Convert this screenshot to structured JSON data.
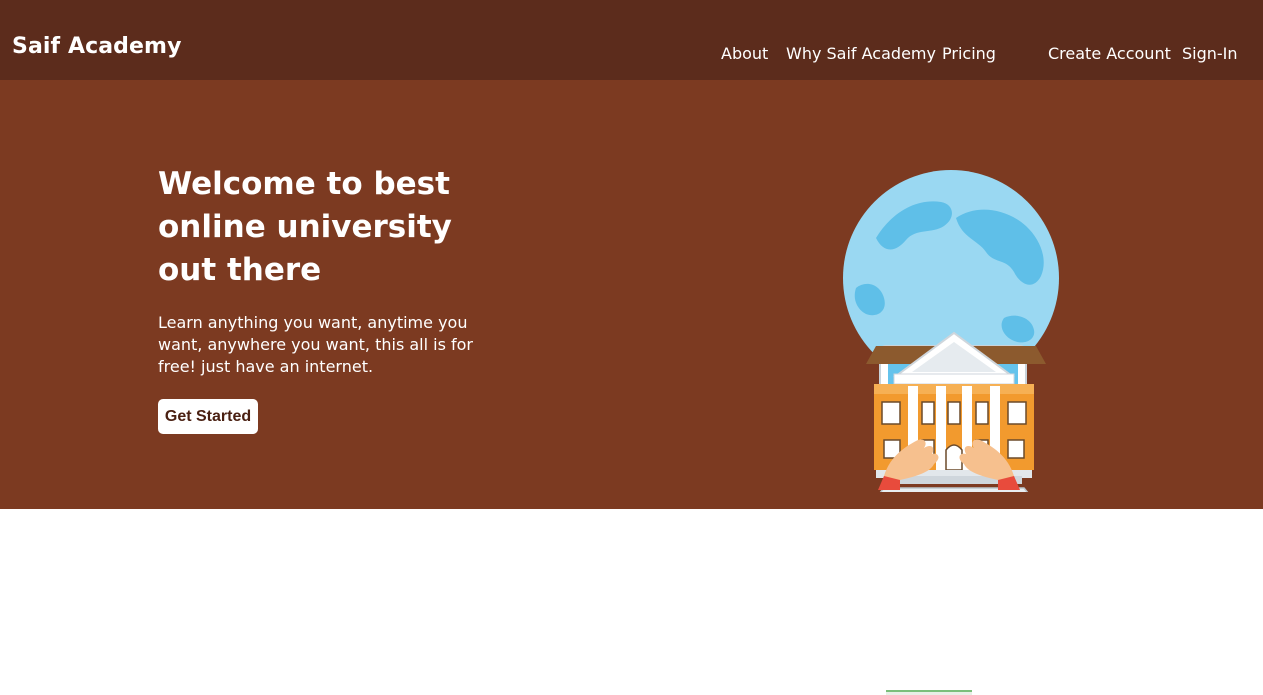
{
  "nav": {
    "brand": "Saif Academy",
    "links": {
      "about": "About",
      "why": "Why Saif Academy",
      "pricing": "Pricing",
      "create_account": "Create Account",
      "sign_in": "Sign-In"
    }
  },
  "hero": {
    "title": "Welcome to best online university out there",
    "text": "Learn anything you want, anytime you want, anywhere you want, this all is for free! just have an internet.",
    "cta_label": "Get Started",
    "illustration_icon": "university-laptop-globe-illustration"
  },
  "colors": {
    "nav_bg": "#5c2c1c",
    "hero_bg": "#7c3a21",
    "text": "#ffffff",
    "cta_text": "#4a2012"
  }
}
